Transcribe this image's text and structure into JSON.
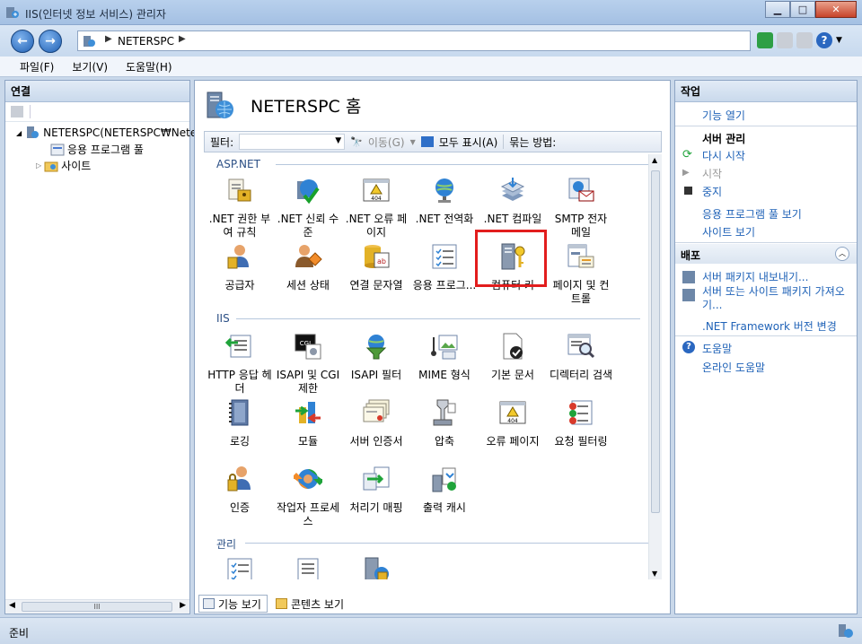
{
  "window": {
    "title": "IIS(인터넷 정보 서비스) 관리자"
  },
  "address": {
    "crumb": "NETERSPC"
  },
  "menu": [
    "파일(F)",
    "보기(V)",
    "도움말(H)"
  ],
  "left": {
    "header": "연결",
    "tree": [
      {
        "label": "NETERSPC(NETERSPC₩Neter"
      },
      {
        "label": "응용 프로그램 풀"
      },
      {
        "label": "사이트"
      }
    ],
    "hscroll_label": "III"
  },
  "center": {
    "title": "NETERSPC 홈",
    "filter": {
      "label": "필터:",
      "go": "이동(G)",
      "showall": "모두 표시(A)",
      "groupby": "묶는 방법:"
    },
    "sections": [
      {
        "label": "ASP.NET",
        "items": [
          {
            "label": ".NET 권한 부여 규칙",
            "icon": "net-authorization-icon"
          },
          {
            "label": ".NET 신뢰 수준",
            "icon": "net-trust-icon"
          },
          {
            "label": ".NET 오류 페이지",
            "icon": "net-error-pages-icon"
          },
          {
            "label": ".NET 전역화",
            "icon": "net-globalization-icon"
          },
          {
            "label": ".NET 컴파일",
            "icon": "net-compilation-icon"
          },
          {
            "label": "SMTP 전자 메일",
            "icon": "smtp-email-icon"
          },
          {
            "label": "공급자",
            "icon": "providers-icon"
          },
          {
            "label": "세션 상태",
            "icon": "session-state-icon"
          },
          {
            "label": "연결 문자열",
            "icon": "connection-strings-icon"
          },
          {
            "label": "응용 프로그...",
            "icon": "app-settings-icon"
          },
          {
            "label": "컴퓨터 키",
            "icon": "machine-key-icon"
          },
          {
            "label": "페이지 및 컨트롤",
            "icon": "pages-controls-icon"
          }
        ]
      },
      {
        "label": "IIS",
        "items": [
          {
            "label": "HTTP 응답 헤더",
            "icon": "http-headers-icon"
          },
          {
            "label": "ISAPI 및 CGI 제한",
            "icon": "isapi-cgi-icon"
          },
          {
            "label": "ISAPI 필터",
            "icon": "isapi-filters-icon"
          },
          {
            "label": "MIME 형식",
            "icon": "mime-types-icon"
          },
          {
            "label": "기본 문서",
            "icon": "default-document-icon"
          },
          {
            "label": "디렉터리 검색",
            "icon": "directory-browsing-icon"
          },
          {
            "label": "로깅",
            "icon": "logging-icon"
          },
          {
            "label": "모듈",
            "icon": "modules-icon"
          },
          {
            "label": "서버 인증서",
            "icon": "server-certificates-icon"
          },
          {
            "label": "압축",
            "icon": "compression-icon"
          },
          {
            "label": "오류 페이지",
            "icon": "error-pages-icon"
          },
          {
            "label": "요청 필터링",
            "icon": "request-filtering-icon"
          },
          {
            "label": "인증",
            "icon": "authentication-icon"
          },
          {
            "label": "작업자 프로세스",
            "icon": "worker-processes-icon"
          },
          {
            "label": "처리기 매핑",
            "icon": "handler-mappings-icon"
          },
          {
            "label": "출력 캐시",
            "icon": "output-caching-icon"
          }
        ]
      },
      {
        "label": "관리",
        "items": []
      }
    ],
    "tabs": [
      {
        "label": "기능 보기"
      },
      {
        "label": "콘텐츠 보기"
      }
    ]
  },
  "right": {
    "header": "작업",
    "open_feature": "기능 열기",
    "server_group": "서버 관리",
    "restart": "다시 시작",
    "start": "시작",
    "stop": "중지",
    "view_pools": "응용 프로그램 풀 보기",
    "view_sites": "사이트 보기",
    "deploy_header": "배포",
    "export": "서버 패키지 내보내기...",
    "import": "서버 또는 사이트 패키지 가져오기...",
    "netfx": ".NET Framework 버전 변경",
    "help": "도움말",
    "online_help": "온라인 도움말"
  },
  "status": {
    "text": "준비"
  }
}
